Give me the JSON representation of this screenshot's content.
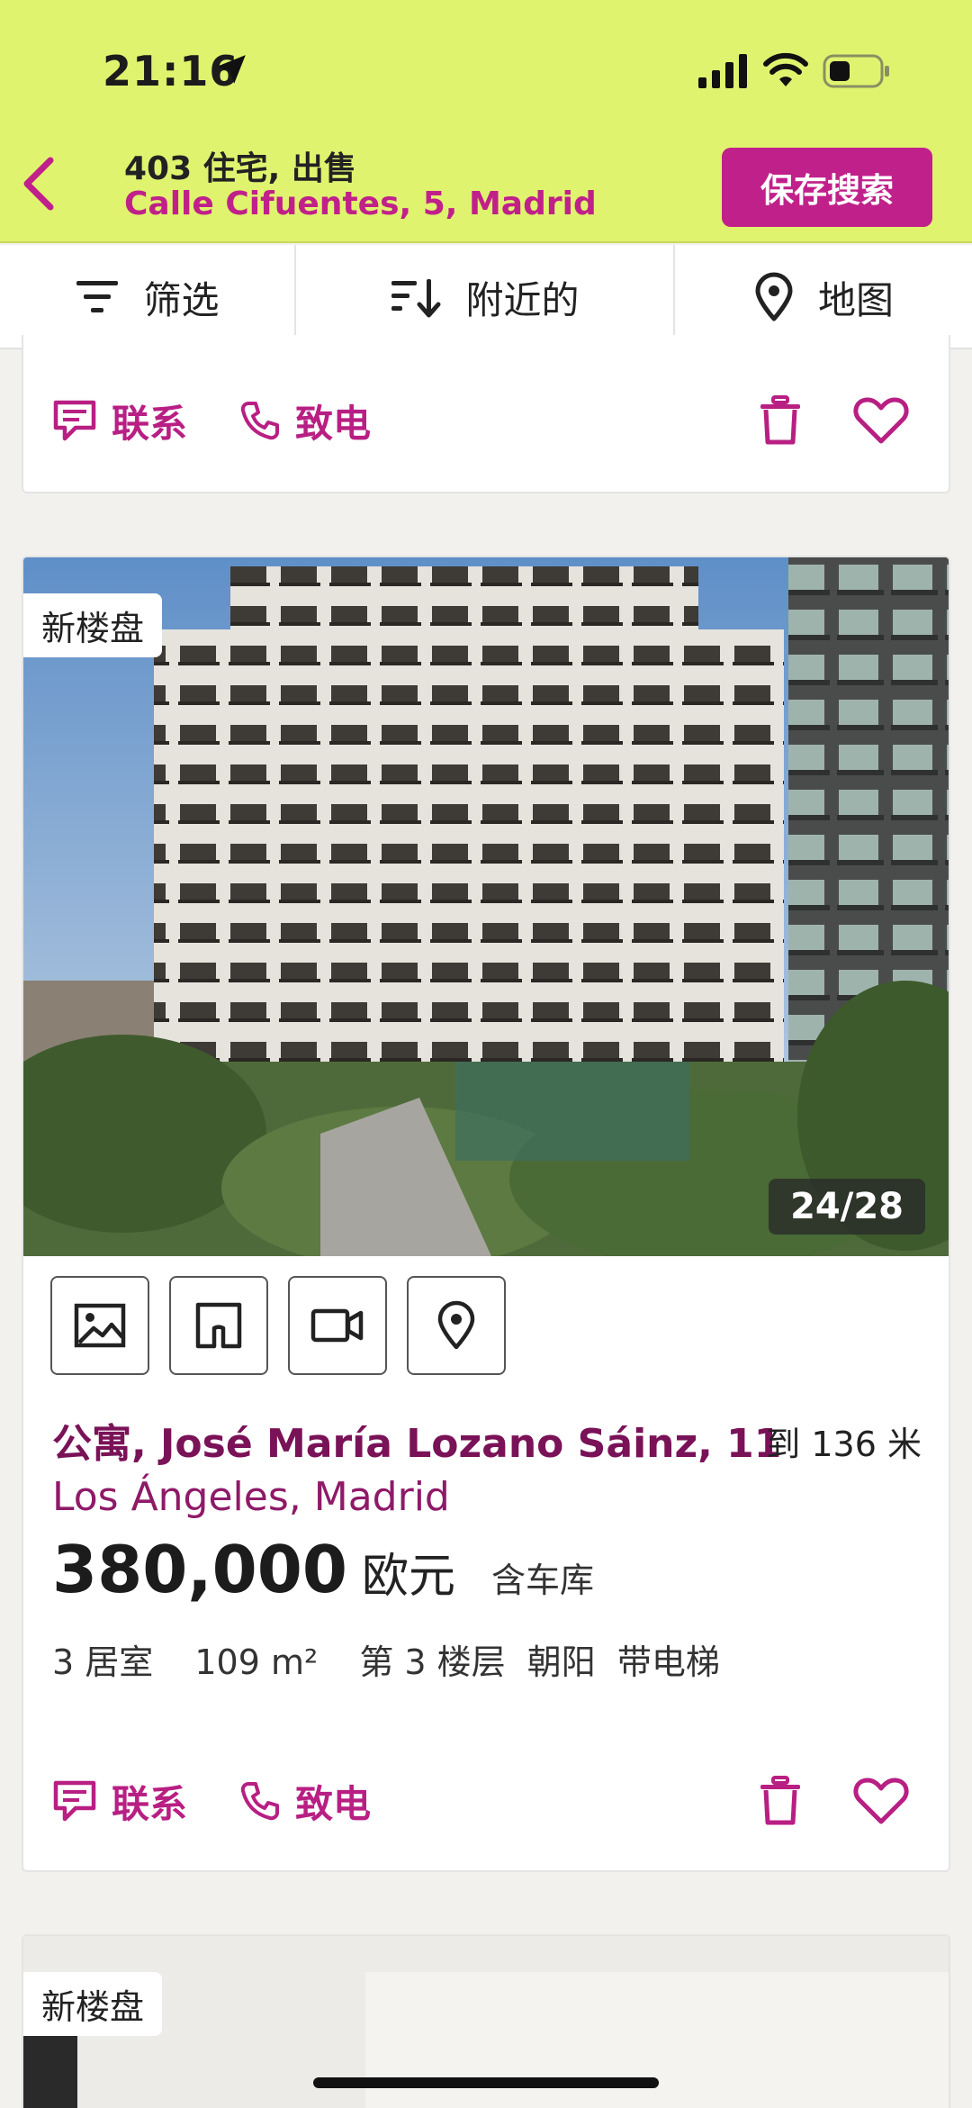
{
  "status_bar": {
    "time": "21:16"
  },
  "header": {
    "title": "403 住宅, 出售",
    "subtitle": "Calle Cifuentes, 5, Madrid",
    "save_label": "保存搜索"
  },
  "filters": [
    {
      "label": "筛选",
      "icon": "filter-icon"
    },
    {
      "label": "附近的",
      "icon": "sort-icon"
    },
    {
      "label": "地图",
      "icon": "map-pin-icon"
    }
  ],
  "actions": {
    "contact_label": "联系",
    "call_label": "致电"
  },
  "listings": [
    {
      "badge": "新楼盘",
      "photo_counter": "24/28",
      "title": "公寓, José María Lozano Sáinz, 11",
      "distance": "到 136 米",
      "area": "Los Ángeles, Madrid",
      "price": "380,000",
      "currency": "欧元",
      "extra": "含车库",
      "rooms": "3 居室",
      "size": "109 m²",
      "floor": "第 3 楼层",
      "orientation": "朝阳",
      "elevator": "带电梯"
    },
    {
      "badge": "新楼盘"
    }
  ],
  "colors": {
    "header_bg": "#e0f36f",
    "accent": "#c0208a",
    "title_dark_magenta": "#7a1258"
  }
}
